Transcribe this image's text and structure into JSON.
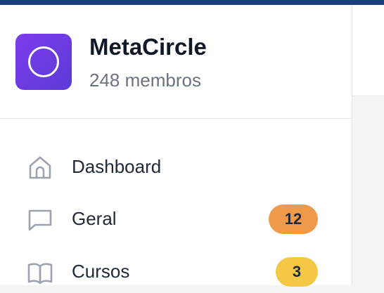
{
  "community": {
    "name": "MetaCircle",
    "members": "248 membros"
  },
  "nav": {
    "items": [
      {
        "label": "Dashboard",
        "icon": "home-icon"
      },
      {
        "label": "Geral",
        "icon": "message-square-icon",
        "badge": "12",
        "badge_color": "#ee9a4a"
      },
      {
        "label": "Cursos",
        "icon": "book-open-icon",
        "badge": "3",
        "badge_color": "#f4c744"
      }
    ]
  },
  "colors": {
    "top_accent": "#1d3f7e",
    "logo_gradient_start": "#7d3cec",
    "logo_gradient_end": "#5b3ad6"
  }
}
